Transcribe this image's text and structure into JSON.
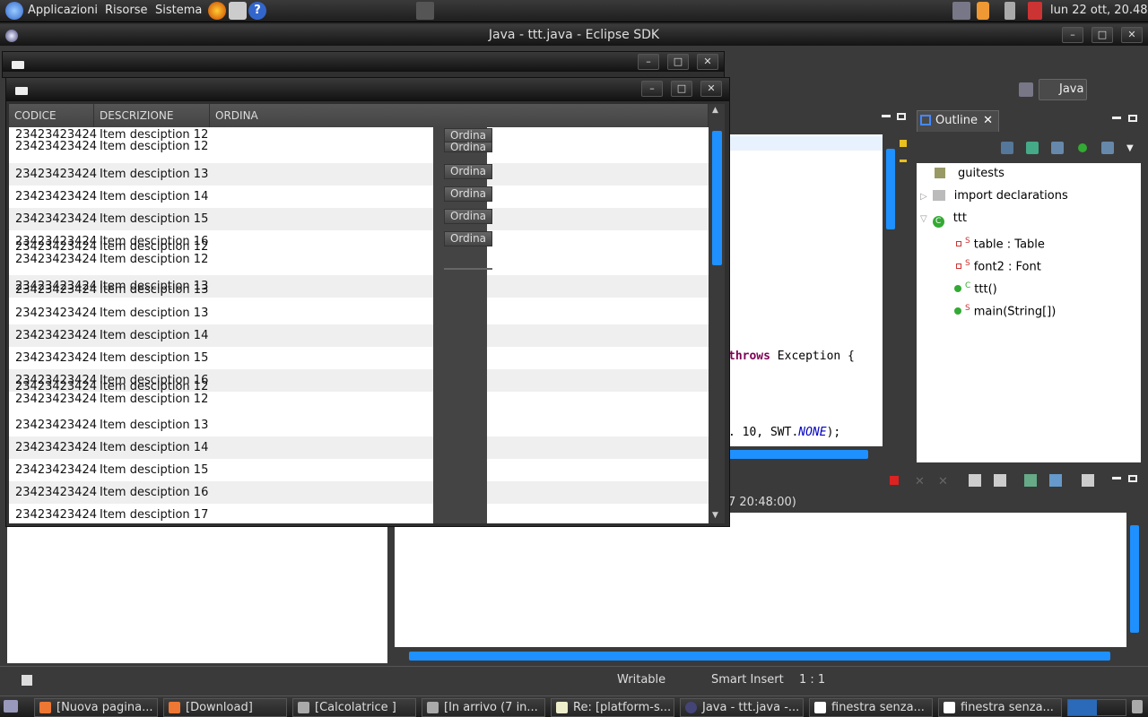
{
  "top_panel": {
    "menus": [
      "Applicazioni",
      "Risorse",
      "Sistema"
    ],
    "clock": "lun 22 ott, 20.48"
  },
  "eclipse": {
    "title": "Java - ttt.java - Eclipse SDK",
    "perspective": "Java",
    "editor_lines": [
      {
        "kw": "throws",
        "text": " Exception {"
      },
      {
        "kw": "",
        "text": ". 10, SWT.",
        "italic": "NONE",
        "tail": ");"
      }
    ],
    "outline": {
      "tab": "Outline",
      "items": [
        {
          "label": "guitests",
          "icon": "package-icon",
          "indent": 0
        },
        {
          "label": "import declarations",
          "icon": "imports-icon",
          "indent": 0
        },
        {
          "label": "ttt",
          "icon": "class-icon",
          "indent": 0
        },
        {
          "label": "table : Table",
          "icon": "static-field-icon",
          "badge": "S",
          "indent": 1
        },
        {
          "label": "font2 : Font",
          "icon": "static-field-icon",
          "badge": "S",
          "indent": 1
        },
        {
          "label": "ttt()",
          "icon": "constructor-icon",
          "badge": "C",
          "indent": 1
        },
        {
          "label": "main(String[])",
          "icon": "method-icon",
          "badge": "S",
          "indent": 1
        }
      ]
    },
    "console_header": "7 20:48:00)",
    "status": {
      "writable": "Writable",
      "insert": "Smart Insert",
      "position": "1 : 1"
    }
  },
  "table_window": {
    "columns": [
      "CODICE",
      "DESCRIZIONE",
      "ORDINA"
    ],
    "button_label": "Ordina",
    "rows": [
      {
        "code": "23423423424",
        "desc": "Item desciption 13"
      },
      {
        "code": "23423423424",
        "desc": "Item desciption 14"
      },
      {
        "code": "23423423424",
        "desc": "Item desciption 15"
      },
      {
        "code": "23423423424",
        "desc": "Item desciption 16"
      },
      {
        "code": "23423423424",
        "desc": "Item desciption 13"
      },
      {
        "code": "23423423424",
        "desc": "Item desciption 13"
      },
      {
        "code": "23423423424",
        "desc": "Item desciption 14"
      },
      {
        "code": "23423423424",
        "desc": "Item desciption 15"
      },
      {
        "code": "23423423424",
        "desc": "Item desciption 16"
      },
      {
        "code": "23423423424",
        "desc": "Item desciption 13"
      },
      {
        "code": "23423423424",
        "desc": "Item desciption 14"
      },
      {
        "code": "23423423424",
        "desc": "Item desciption 15"
      },
      {
        "code": "23423423424",
        "desc": "Item desciption 16"
      },
      {
        "code": "23423423424",
        "desc": "Item desciption 17"
      }
    ],
    "ghost_desc": "Item desciption 12"
  },
  "taskbar": {
    "tasks": [
      "[Nuova pagina...",
      "[Download]",
      "[Calcolatrice ]",
      "[In arrivo (7 in...",
      "Re: [platform-s...",
      "Java - ttt.java -...",
      "finestra senza...",
      "finestra senza..."
    ]
  },
  "colors": {
    "accent": "#1e90ff",
    "keyword": "#7f0055"
  }
}
